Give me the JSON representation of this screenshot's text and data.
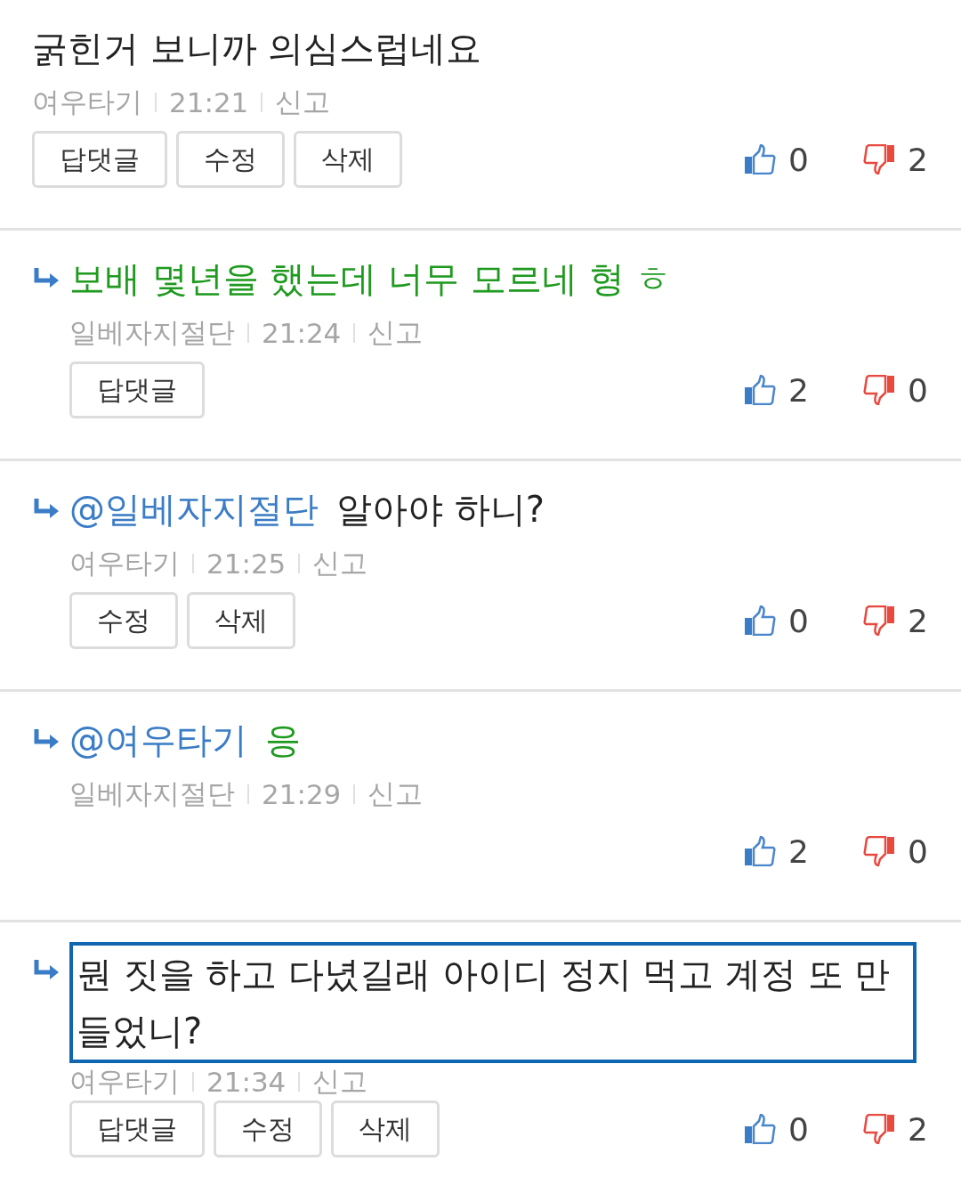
{
  "comments": [
    {
      "reply": false,
      "text": "굵힌거 보니까 의심스럽네요",
      "color": "#222222",
      "highlighted": false,
      "author": "여우타기",
      "time": "21:21",
      "report": "신고",
      "buttons": [
        "답댓글",
        "수정",
        "삭제"
      ],
      "likes": "0",
      "dislikes": "2"
    },
    {
      "reply": true,
      "text": "보배 몇년을 했는데 너무 모르네 형 ㅎ",
      "color": "#1e9a1e",
      "highlighted": false,
      "author": "일베자지절단",
      "time": "21:24",
      "report": "신고",
      "buttons": [
        "답댓글"
      ],
      "likes": "2",
      "dislikes": "0"
    },
    {
      "reply": true,
      "mention": "@일베자지절단",
      "text": "알아야 하니?",
      "color": "#222222",
      "highlighted": false,
      "author": "여우타기",
      "time": "21:25",
      "report": "신고",
      "buttons": [
        "수정",
        "삭제"
      ],
      "likes": "0",
      "dislikes": "2"
    },
    {
      "reply": true,
      "mention": "@여우타기",
      "text": "응",
      "color": "#1e9a1e",
      "highlighted": false,
      "author": "일베자지절단",
      "time": "21:29",
      "report": "신고",
      "likes": "2",
      "dislikes": "0"
    },
    {
      "reply": true,
      "text": "뭔 짓을 하고 다녔길래 아이디 정지 먹고 계정 또 만들었니?",
      "color": "#222222",
      "highlighted": true,
      "author": "여우타기",
      "time": "21:34",
      "report": "신고",
      "buttons": [
        "답댓글",
        "수정",
        "삭제"
      ],
      "likes": "0",
      "dislikes": "2"
    }
  ]
}
